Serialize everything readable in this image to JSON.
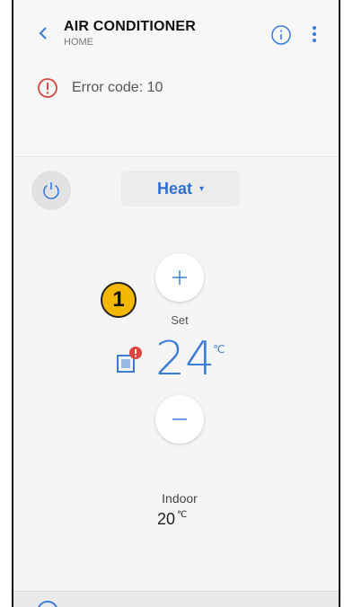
{
  "header": {
    "title": "AIR CONDITIONER",
    "subtitle": "HOME",
    "back_icon": "chevron-left-icon",
    "info_icon": "info-icon",
    "more_icon": "more-vertical-icon"
  },
  "error": {
    "icon": "alert-circle-icon",
    "text": "Error code: 10"
  },
  "controls": {
    "power_icon": "power-icon",
    "mode_label": "Heat",
    "mode_caret": "▾",
    "badge_number": "1",
    "plus_label": "+",
    "minus_label": "−",
    "set_label": "Set",
    "set_temperature": "24",
    "temperature_unit": "℃"
  },
  "indoor": {
    "label": "Indoor",
    "value": "20",
    "unit": "℃"
  },
  "colors": {
    "accent": "#3a7bd5",
    "error": "#d9463b",
    "badge": "#f5b800"
  }
}
